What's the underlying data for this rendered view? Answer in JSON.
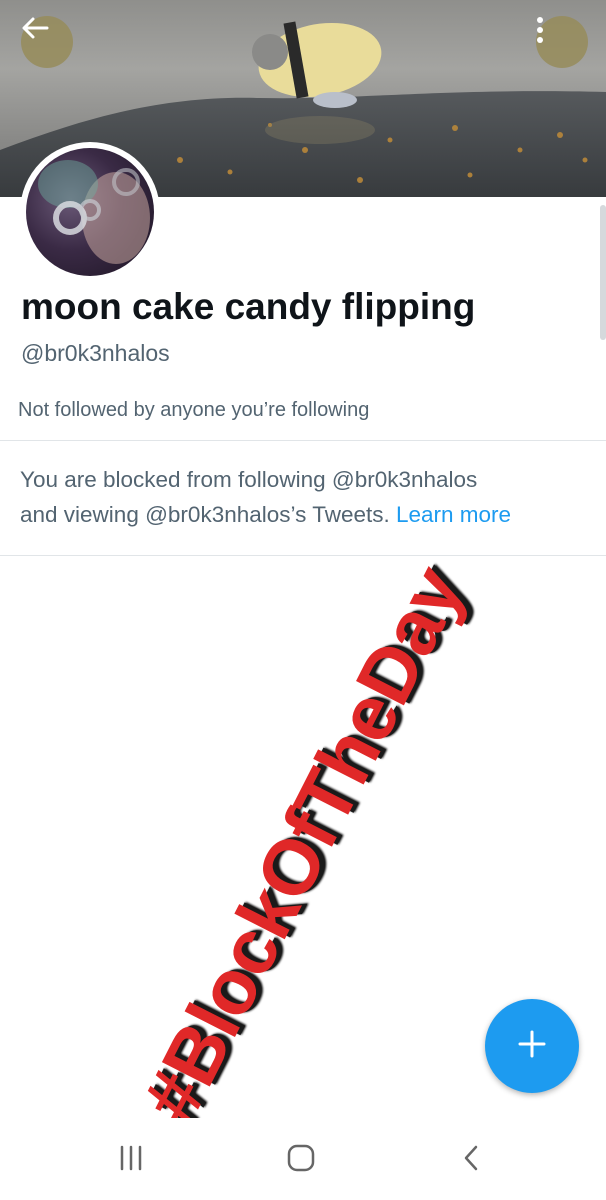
{
  "profile": {
    "display_name": "moon cake candy flipping",
    "handle": "@br0k3nhalos",
    "followed_note": "Not followed by anyone you’re following"
  },
  "blocked_notice": {
    "line1": "You are blocked from following @br0k3nhalos",
    "line2": "and viewing @br0k3nhalos’s Tweets.",
    "learn_more": "Learn more"
  },
  "overlay": {
    "hashtag": "#BlockOfTheDay"
  },
  "icons": {
    "back": "arrow-left-icon",
    "more": "more-vertical-icon",
    "compose": "plus-icon",
    "recents": "recents-icon",
    "home": "home-icon",
    "nav_back": "chevron-left-icon"
  },
  "colors": {
    "accent": "#1d9bf0",
    "hashtag": "#e02828",
    "secondary_text": "#536471"
  }
}
